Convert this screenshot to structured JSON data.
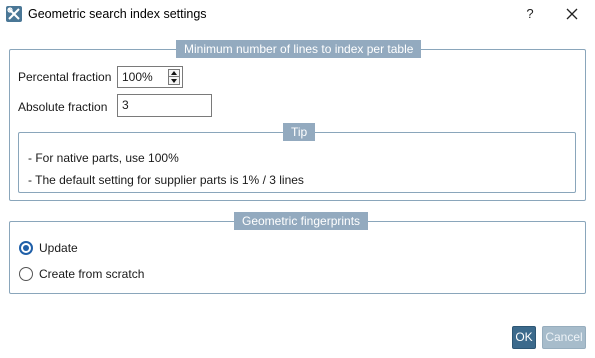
{
  "window": {
    "title": "Geometric search index settings",
    "help_label": "?"
  },
  "min_lines": {
    "title": "Minimum number of lines to index per table",
    "percental_label": "Percental fraction",
    "percental_value": "100%",
    "absolute_label": "Absolute fraction",
    "absolute_value": "3"
  },
  "tip": {
    "title": "Tip",
    "lines": [
      "- For native parts, use 100%",
      "- The default setting for supplier parts is 1% / 3 lines"
    ]
  },
  "fingerprints": {
    "title": "Geometric fingerprints",
    "options": [
      {
        "label": "Update",
        "selected": true
      },
      {
        "label": "Create from scratch",
        "selected": false
      }
    ]
  },
  "buttons": {
    "ok": "OK",
    "cancel": "Cancel"
  },
  "colors": {
    "accent": "#3c6a8c",
    "group_title_bg": "#93aabf",
    "radio_selected": "#1f5fa8"
  }
}
